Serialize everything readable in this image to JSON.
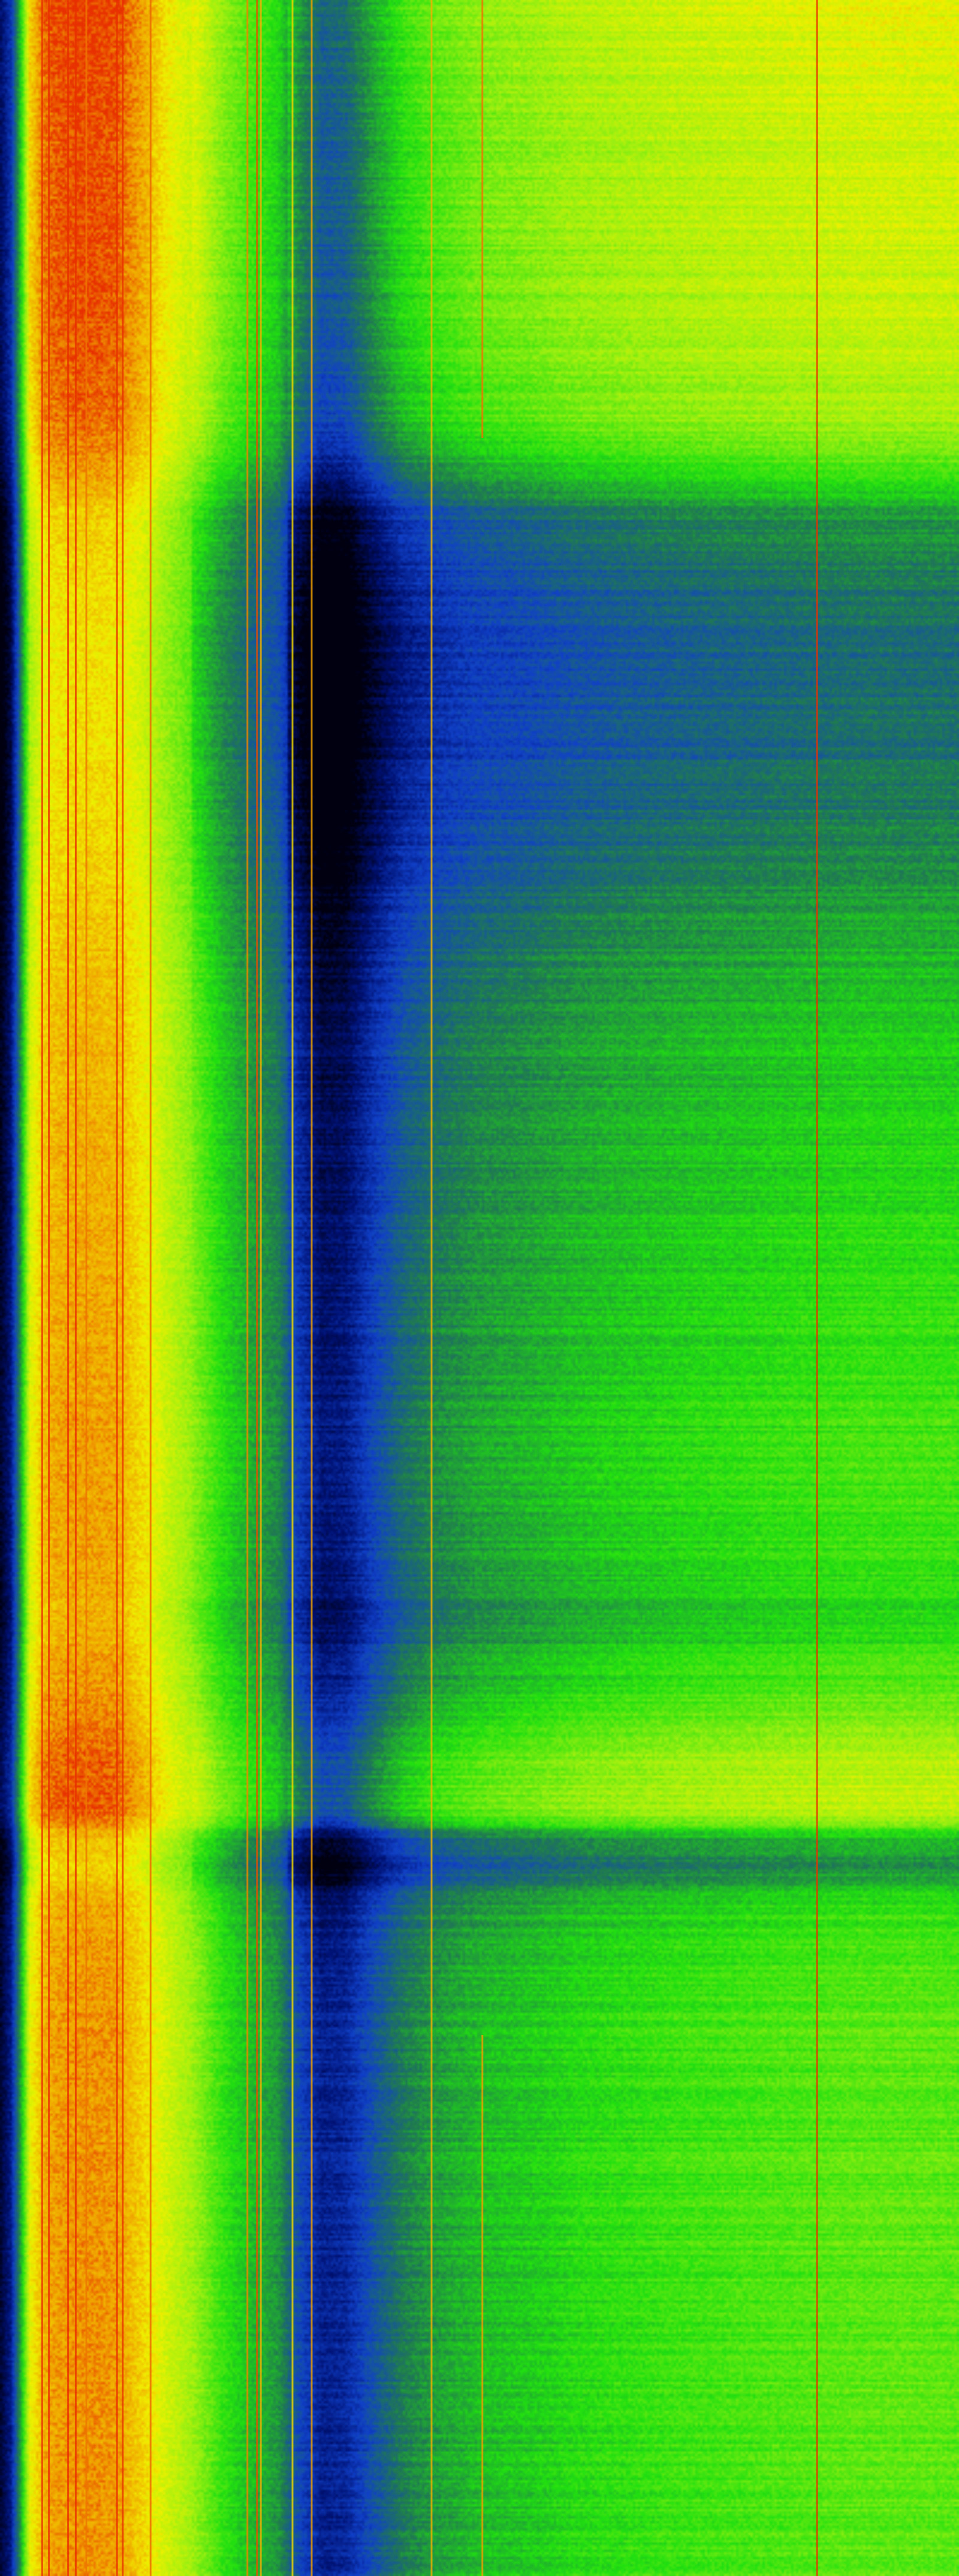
{
  "chart_data": {
    "type": "heatmap",
    "title": "",
    "xlabel": "",
    "ylabel": "",
    "x_range": [
      0,
      1
    ],
    "y_range": [
      0,
      1
    ],
    "axes_visible": false,
    "legend": "none",
    "grid": false,
    "colormap": {
      "name": "blue-green-yellow-red",
      "stops": [
        {
          "value": 0.0,
          "color": "#000010"
        },
        {
          "value": 0.12,
          "color": "#001070"
        },
        {
          "value": 0.25,
          "color": "#1040c8"
        },
        {
          "value": 0.4,
          "color": "#207a50"
        },
        {
          "value": 0.55,
          "color": "#20e010"
        },
        {
          "value": 0.7,
          "color": "#a0f010"
        },
        {
          "value": 0.82,
          "color": "#f0f000"
        },
        {
          "value": 0.92,
          "color": "#f0a000"
        },
        {
          "value": 1.0,
          "color": "#e83000"
        }
      ]
    },
    "column_profile": {
      "x": [
        0.0,
        0.01,
        0.02,
        0.03,
        0.045,
        0.06,
        0.09,
        0.12,
        0.15,
        0.17,
        0.2,
        0.23,
        0.26,
        0.29,
        0.31,
        0.335,
        0.36,
        0.39,
        0.42,
        0.45,
        0.5,
        0.55,
        0.6,
        0.7,
        0.8,
        0.9,
        1.0
      ],
      "value": [
        0.05,
        0.15,
        0.45,
        0.8,
        0.9,
        0.92,
        0.93,
        0.92,
        0.85,
        0.78,
        0.7,
        0.58,
        0.5,
        0.44,
        0.28,
        0.16,
        0.18,
        0.3,
        0.4,
        0.45,
        0.5,
        0.52,
        0.55,
        0.58,
        0.6,
        0.62,
        0.62
      ]
    },
    "row_profile": {
      "y": [
        0.0,
        0.04,
        0.08,
        0.12,
        0.16,
        0.18,
        0.2,
        0.23,
        0.26,
        0.29,
        0.32,
        0.36,
        0.4,
        0.44,
        0.48,
        0.52,
        0.56,
        0.6,
        0.63,
        0.66,
        0.68,
        0.695,
        0.705,
        0.715,
        0.725,
        0.74,
        0.76,
        0.79,
        0.82,
        0.86,
        0.9,
        0.95,
        1.0
      ],
      "value": [
        0.18,
        0.16,
        0.15,
        0.14,
        0.1,
        0.0,
        -0.18,
        -0.24,
        -0.26,
        -0.25,
        -0.22,
        -0.14,
        -0.1,
        -0.08,
        -0.06,
        -0.05,
        -0.03,
        -0.04,
        -0.08,
        0.02,
        0.1,
        0.14,
        0.12,
        -0.14,
        -0.18,
        -0.05,
        -0.02,
        0.0,
        0.0,
        0.0,
        0.0,
        0.0,
        0.0
      ]
    },
    "vertical_lines": [
      {
        "x": 0.044,
        "value": 1.0,
        "y_start": 0.0,
        "y_end": 1.0
      },
      {
        "x": 0.051,
        "value": 1.0,
        "y_start": 0.0,
        "y_end": 1.0
      },
      {
        "x": 0.071,
        "value": 1.0,
        "y_start": 0.0,
        "y_end": 1.0
      },
      {
        "x": 0.079,
        "value": 1.0,
        "y_start": 0.0,
        "y_end": 1.0
      },
      {
        "x": 0.09,
        "value": 0.95,
        "y_start": 0.0,
        "y_end": 1.0
      },
      {
        "x": 0.122,
        "value": 1.0,
        "y_start": 0.0,
        "y_end": 1.0
      },
      {
        "x": 0.128,
        "value": 1.0,
        "y_start": 0.0,
        "y_end": 1.0
      },
      {
        "x": 0.157,
        "value": 0.96,
        "y_start": 0.0,
        "y_end": 1.0
      },
      {
        "x": 0.258,
        "value": 0.94,
        "y_start": 0.0,
        "y_end": 1.0
      },
      {
        "x": 0.268,
        "value": 0.98,
        "y_start": 0.0,
        "y_end": 1.0
      },
      {
        "x": 0.272,
        "value": 0.9,
        "y_start": 0.0,
        "y_end": 1.0
      },
      {
        "x": 0.305,
        "value": 0.85,
        "y_start": 0.0,
        "y_end": 1.0
      },
      {
        "x": 0.325,
        "value": 0.92,
        "y_start": 0.0,
        "y_end": 1.0
      },
      {
        "x": 0.45,
        "value": 0.9,
        "y_start": 0.0,
        "y_end": 1.0
      },
      {
        "x": 0.503,
        "value": 0.95,
        "y_start": 0.0,
        "y_end": 0.17
      },
      {
        "x": 0.503,
        "value": 0.92,
        "y_start": 0.79,
        "y_end": 1.0
      },
      {
        "x": 0.852,
        "value": 1.0,
        "y_start": 0.0,
        "y_end": 1.0
      }
    ]
  }
}
